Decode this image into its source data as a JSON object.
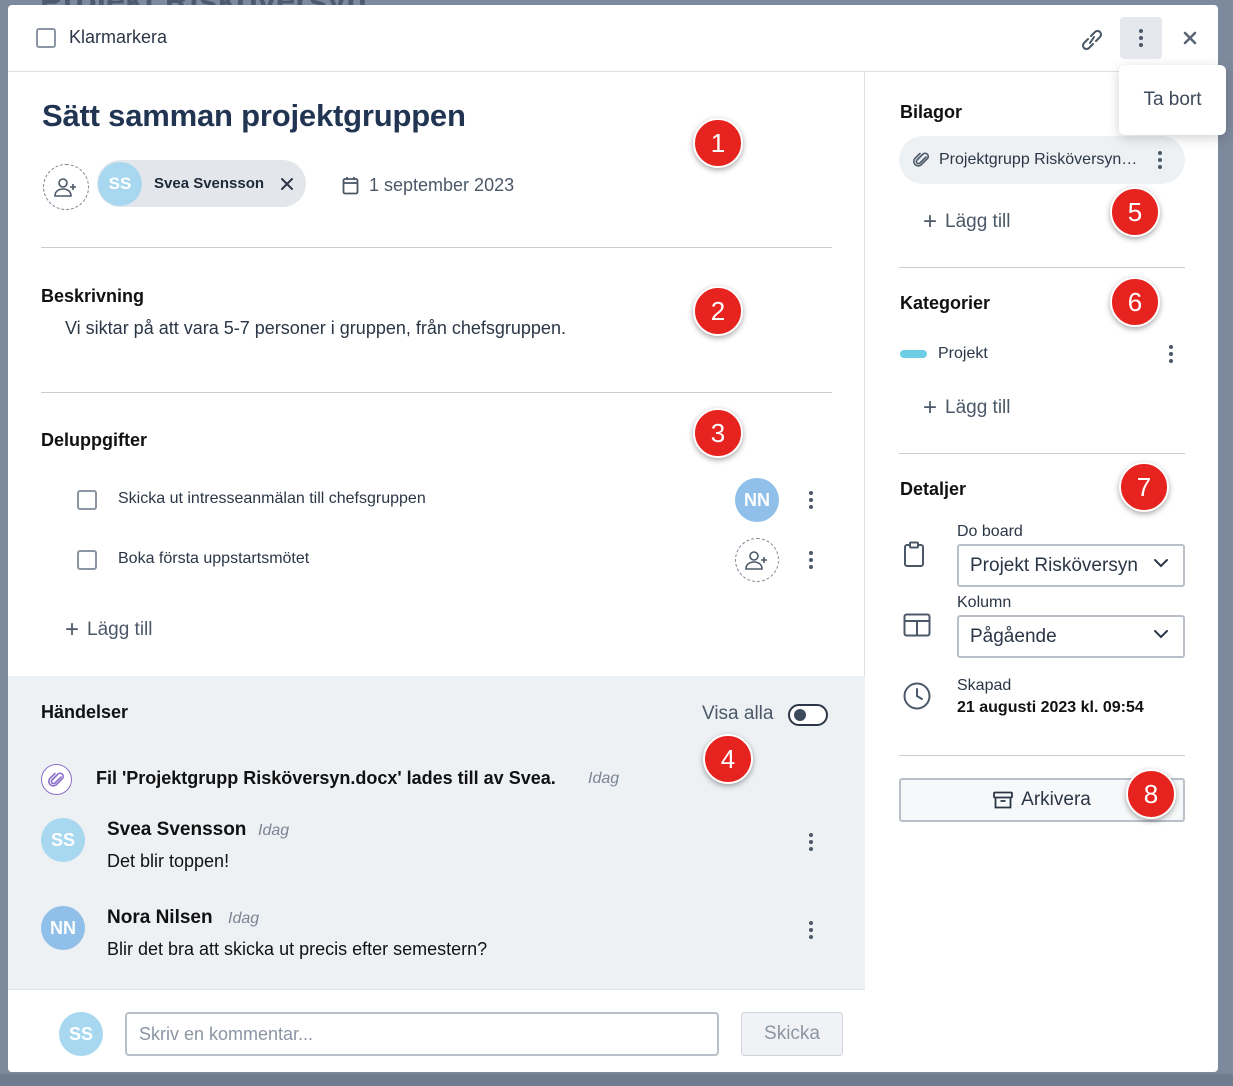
{
  "background": {
    "title": "Projekt Risköversyn"
  },
  "topbar": {
    "done_label": "Klarmarkera"
  },
  "menu": {
    "delete_label": "Ta bort"
  },
  "task": {
    "title": "Sätt samman projektgruppen",
    "assignee": {
      "initials": "SS",
      "name": "Svea Svensson"
    },
    "due_date": "1 september 2023"
  },
  "description": {
    "heading": "Beskrivning",
    "text": "Vi siktar på att vara 5-7 personer i gruppen, från chefsgruppen."
  },
  "subtasks": {
    "heading": "Deluppgifter",
    "items": [
      {
        "label": "Skicka ut intresseanmälan till chefsgruppen",
        "assignee_initials": "NN"
      },
      {
        "label": "Boka första uppstartsmötet",
        "assignee_initials": ""
      }
    ],
    "add_label": "Lägg till"
  },
  "events": {
    "heading": "Händelser",
    "show_all_label": "Visa alla",
    "show_all_on": false,
    "file_event": {
      "text": "Fil 'Projektgrupp Risköversyn.docx' lades till av Svea.",
      "time": "Idag"
    },
    "comments": [
      {
        "initials": "SS",
        "author": "Svea Svensson",
        "time": "Idag",
        "text": "Det blir toppen!"
      },
      {
        "initials": "NN",
        "author": "Nora Nilsen",
        "time": "Idag",
        "text": "Blir det bra att skicka ut precis efter semestern?"
      }
    ]
  },
  "composer": {
    "initials": "SS",
    "placeholder": "Skriv en kommentar...",
    "send_label": "Skicka"
  },
  "sidebar": {
    "attachments": {
      "heading": "Bilagor",
      "file_name": "Projektgrupp Risköversyn.docx",
      "add_label": "Lägg till"
    },
    "categories": {
      "heading": "Kategorier",
      "items": [
        {
          "label": "Projekt",
          "color": "#6dcde4"
        }
      ],
      "add_label": "Lägg till"
    },
    "details": {
      "heading": "Detaljer",
      "board_label": "Do board",
      "board_value": "Projekt Risköversyn",
      "column_label": "Kolumn",
      "column_value": "Pågående",
      "created_label": "Skapad",
      "created_value": "21 augusti 2023 kl. 09:54"
    },
    "archive_label": "Arkivera"
  },
  "badges": [
    "1",
    "2",
    "3",
    "4",
    "5",
    "6",
    "7",
    "8"
  ],
  "colors": {
    "accent_badge": "#e6231e",
    "title": "#213553",
    "avatar_ss": "#a8d8f0",
    "avatar_nn": "#90c0ea"
  }
}
